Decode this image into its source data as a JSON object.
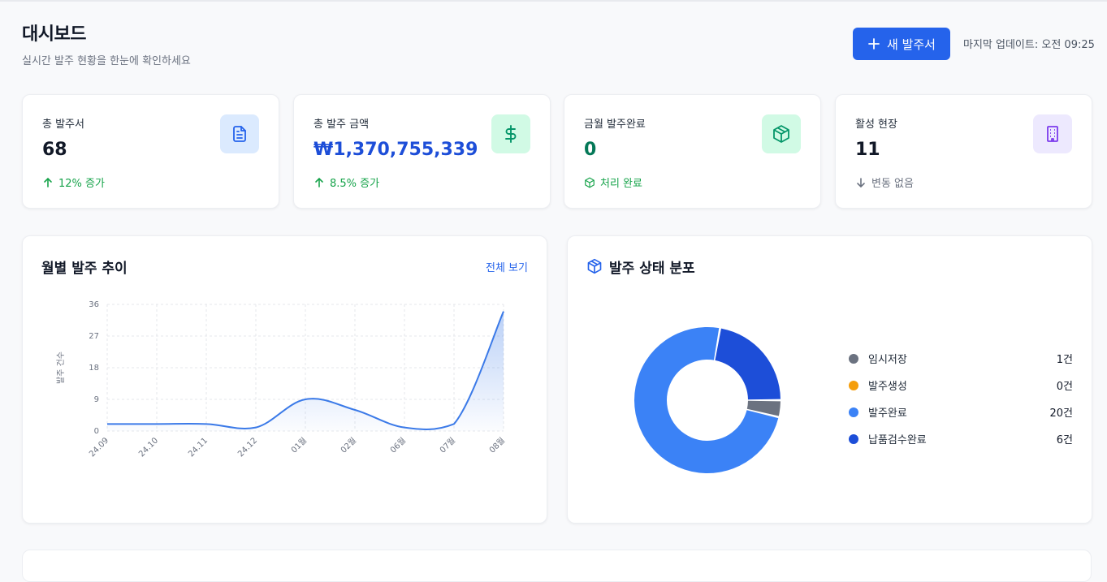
{
  "header": {
    "title": "대시보드",
    "subtitle": "실시간 발주 현황을 한눈에 확인하세요",
    "new_button_label": "새 발주서",
    "last_update": "마지막 업데이트: 오전 09:25"
  },
  "stats": [
    {
      "label": "총 발주서",
      "value": "68",
      "trend": "12% 증가",
      "trend_kind": "up",
      "icon": "document-icon",
      "icon_bg": "#dbeafe",
      "icon_color": "#2563eb"
    },
    {
      "label": "총 발주 금액",
      "value": "₩1,370,755,339",
      "trend": "8.5% 증가",
      "trend_kind": "up",
      "icon": "dollar-icon",
      "icon_bg": "#d1fae5",
      "icon_color": "#059669"
    },
    {
      "label": "금월 발주완료",
      "value": "0",
      "trend": "처리 완료",
      "trend_kind": "done",
      "icon": "package-icon",
      "icon_bg": "#d1fae5",
      "icon_color": "#059669"
    },
    {
      "label": "활성 현장",
      "value": "11",
      "trend": "변동 없음",
      "trend_kind": "none",
      "icon": "building-icon",
      "icon_bg": "#ede9fe",
      "icon_color": "#7c3aed"
    }
  ],
  "monthly_chart": {
    "title": "월별 발주 추이",
    "view_all": "전체 보기"
  },
  "status_chart": {
    "title": "발주 상태 분포"
  },
  "chart_data": [
    {
      "type": "area",
      "title": "월별 발주 추이",
      "ylabel": "발주 건수",
      "categories": [
        "24.09",
        "24.10",
        "24.11",
        "24.12",
        "01월",
        "02월",
        "06월",
        "07월",
        "08월"
      ],
      "values": [
        2,
        2,
        2,
        1,
        9,
        6,
        1,
        2,
        34
      ],
      "yticks": [
        0,
        9,
        18,
        27,
        36
      ],
      "ylim": [
        0,
        36
      ],
      "grid": true,
      "color": "#3b7ae8"
    },
    {
      "type": "pie",
      "title": "발주 상태 분포",
      "legend_position": "right",
      "series": [
        {
          "name": "임시저장",
          "value": 1,
          "label": "1건",
          "color": "#6b7280"
        },
        {
          "name": "발주생성",
          "value": 0,
          "label": "0건",
          "color": "#f59e0b"
        },
        {
          "name": "발주완료",
          "value": 20,
          "label": "20건",
          "color": "#3b82f6"
        },
        {
          "name": "납품검수완료",
          "value": 6,
          "label": "6건",
          "color": "#1d4ed8"
        }
      ]
    }
  ]
}
